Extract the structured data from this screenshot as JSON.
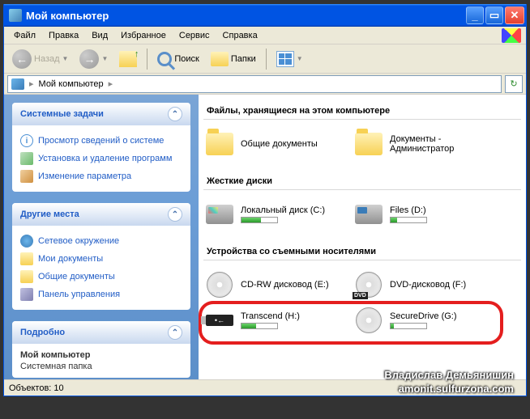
{
  "window": {
    "title": "Мой компьютер"
  },
  "menus": {
    "file": "Файл",
    "edit": "Правка",
    "view": "Вид",
    "favorites": "Избранное",
    "tools": "Сервис",
    "help": "Справка"
  },
  "toolbar": {
    "back": "Назад",
    "search": "Поиск",
    "folders": "Папки"
  },
  "address": {
    "root": "Мой компьютер"
  },
  "sidebar": {
    "tasks": {
      "title": "Системные задачи",
      "items": [
        "Просмотр сведений о системе",
        "Установка и удаление программ",
        "Изменение параметра"
      ]
    },
    "places": {
      "title": "Другие места",
      "items": [
        "Сетевое окружение",
        "Мои документы",
        "Общие документы",
        "Панель управления"
      ]
    },
    "details": {
      "title": "Подробно",
      "name": "Мой компьютер",
      "type": "Системная папка"
    }
  },
  "content": {
    "sections": {
      "files": "Файлы, хранящиеся на этом компьютере",
      "hdd": "Жесткие диски",
      "removable": "Устройства со съемными носителями"
    },
    "files_items": [
      {
        "label": "Общие документы"
      },
      {
        "label": "Документы - Администратор"
      }
    ],
    "hdd_items": [
      {
        "label": "Локальный диск (C:)",
        "fill": 55
      },
      {
        "label": "Files (D:)",
        "fill": 18
      }
    ],
    "removable_items": [
      {
        "label": "CD-RW дисковод (E:)",
        "kind": "cd"
      },
      {
        "label": "DVD-дисковод (F:)",
        "kind": "dvd"
      },
      {
        "label": "Transcend (H:)",
        "kind": "usb",
        "fill": 40
      },
      {
        "label": "SecureDrive (G:)",
        "kind": "hdd",
        "fill": 8
      }
    ]
  },
  "statusbar": {
    "objects": "Объектов: 10"
  },
  "watermark": {
    "line1": "Владислав Демьянишин",
    "line2": "amonit.sulfurzona.com"
  }
}
